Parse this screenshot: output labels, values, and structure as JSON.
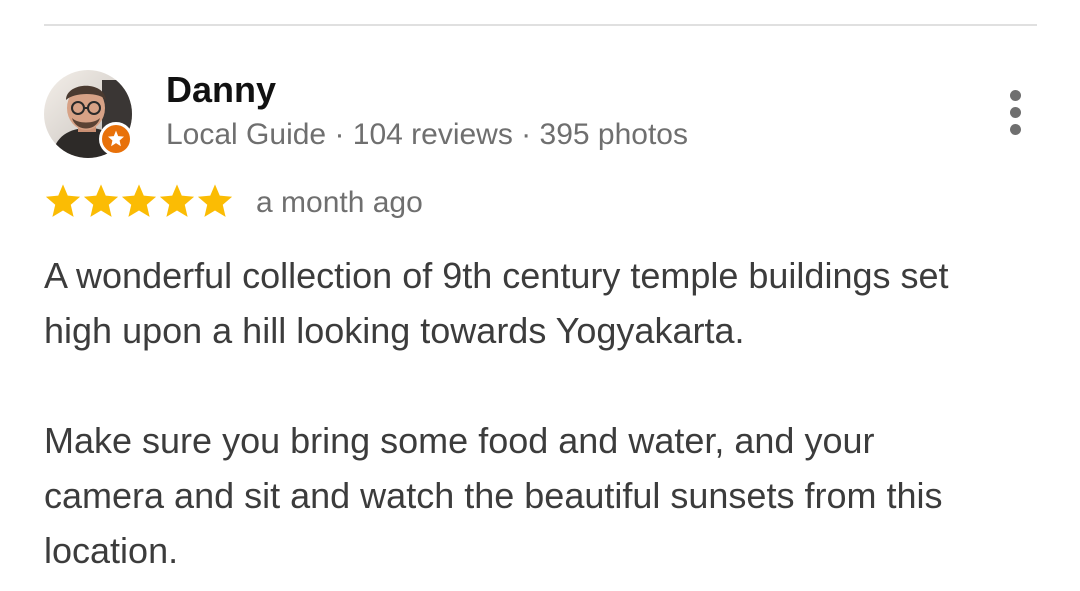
{
  "review": {
    "author": {
      "name": "Danny",
      "meta": "Local Guide · 104 reviews · 395 photos",
      "avatar_icon": "user-avatar-photo",
      "badge_icon": "local-guide-star-icon",
      "badge_color": "#e8710a"
    },
    "rating": {
      "stars": 5,
      "max": 5,
      "star_color": "#fbbc04"
    },
    "time": "a month ago",
    "paragraphs": [
      "A wonderful collection of 9th century temple buildings set high upon a hill looking towards Yogyakarta.",
      "Make sure you bring some food and water, and your camera and sit and watch the beautiful sunsets from this location."
    ],
    "menu_icon": "more-vert-icon"
  }
}
